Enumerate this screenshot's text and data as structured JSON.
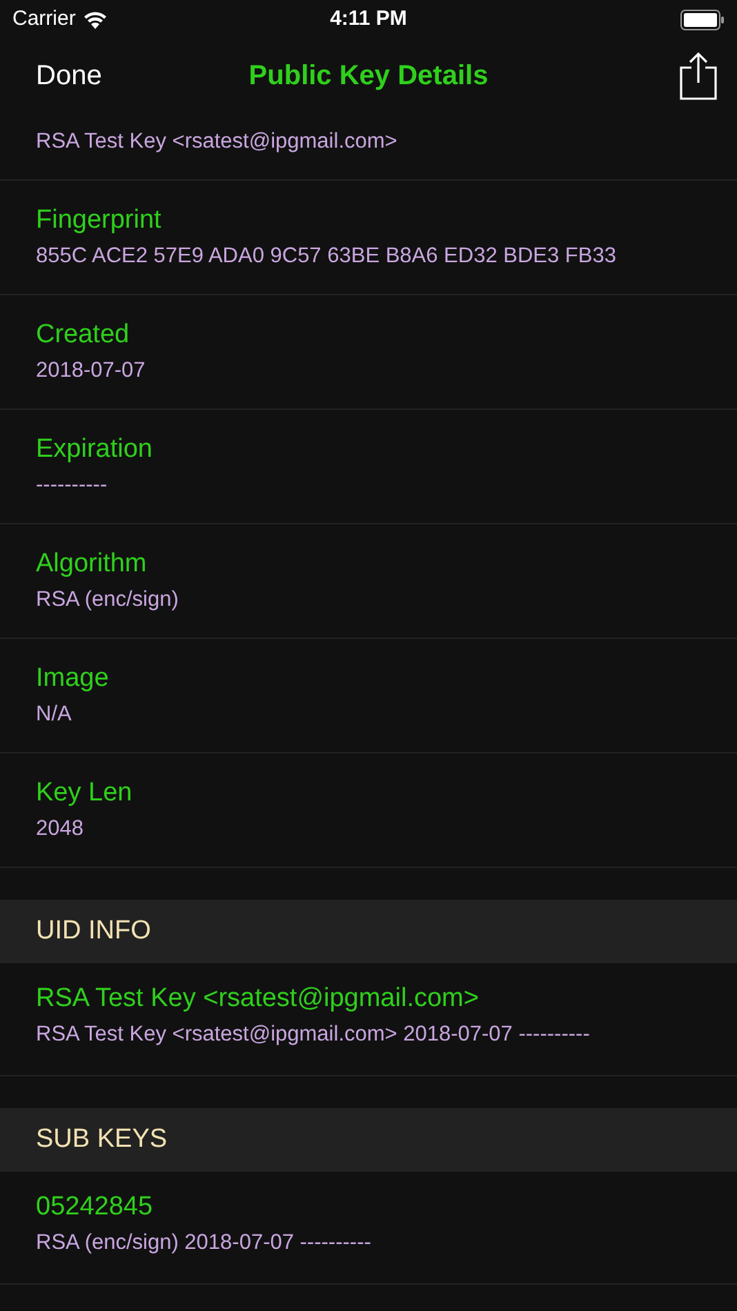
{
  "status_bar": {
    "carrier": "Carrier",
    "time": "4:11 PM"
  },
  "nav": {
    "left": "Done",
    "title": "Public Key Details"
  },
  "partial_value": "RSA Test Key <rsatest@ipgmail.com>",
  "details": [
    {
      "label": "Fingerprint",
      "value": "855C ACE2 57E9 ADA0 9C57 63BE B8A6 ED32 BDE3 FB33"
    },
    {
      "label": "Created",
      "value": "2018-07-07"
    },
    {
      "label": "Expiration",
      "value": "----------"
    },
    {
      "label": "Algorithm",
      "value": "RSA (enc/sign)"
    },
    {
      "label": "Image",
      "value": "N/A"
    },
    {
      "label": "Key Len",
      "value": "2048"
    }
  ],
  "sections": [
    {
      "header": "UID INFO",
      "rows": [
        {
          "label": "RSA Test Key <rsatest@ipgmail.com>",
          "value": "RSA Test Key <rsatest@ipgmail.com> 2018-07-07 ----------"
        }
      ]
    },
    {
      "header": "SUB KEYS",
      "rows": [
        {
          "label": "05242845",
          "value": "RSA (enc/sign) 2018-07-07 ----------"
        }
      ]
    }
  ]
}
